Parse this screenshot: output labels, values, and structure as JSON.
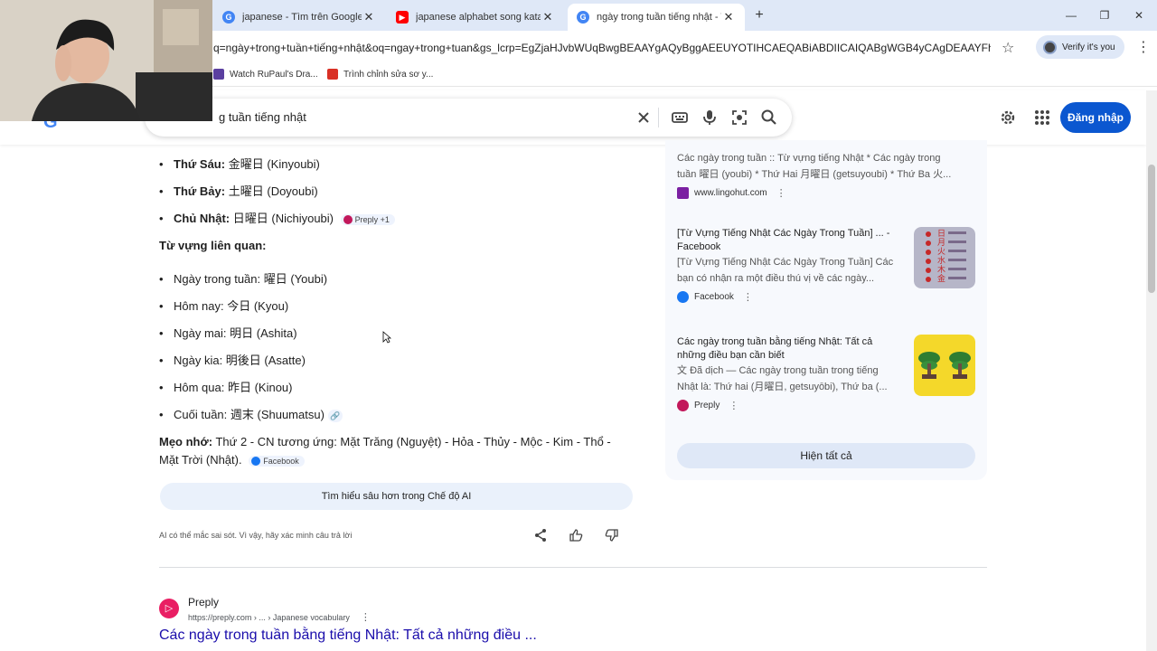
{
  "browser": {
    "tabs": [
      {
        "label": "japanese - Tìm trên Google",
        "favicon": "google-icon",
        "active": false
      },
      {
        "label": "japanese alphabet song katakana",
        "favicon": "youtube-icon",
        "active": false
      },
      {
        "label": "ngày trong tuần tiếng nhật - Tìm",
        "favicon": "google-icon",
        "active": true
      }
    ],
    "new_tab": "+",
    "url": "q=ngày+trong+tuần+tiếng+nhật&oq=ngay+trong+tuan&gs_lcrp=EgZjaHJvbWUqBwgBEAAYgAQyBggAEEUYOTIHCAEQABiABDIICAIQABgWGB4yCAgDEAAYFhgeMg...",
    "profile_label": "Verify it's you",
    "bookmarks": [
      {
        "label": "Watch RuPaul's Dra...",
        "icon": "bookmark-icon"
      },
      {
        "label": "Trình chỉnh sửa sơ y...",
        "icon": "bookmark-icon"
      }
    ]
  },
  "google": {
    "query": "ngày trong tuần tiếng nhật",
    "visible_query": "g tuần tiếng nhật",
    "signin_label": "Đăng nhập"
  },
  "ai_overview": {
    "days": [
      {
        "day": "Thứ Sáu:",
        "kanji": "金曜日",
        "romaji": "(Kinyoubi)"
      },
      {
        "day": "Thứ Bảy:",
        "kanji": "土曜日",
        "romaji": "(Doyoubi)"
      },
      {
        "day": "Chủ Nhật:",
        "kanji": "日曜日",
        "romaji": "(Nichiyoubi)",
        "chip": "Preply +1"
      }
    ],
    "related_heading": "Từ vựng liên quan:",
    "related": [
      {
        "text": "Ngày trong tuần: 曜日 (Youbi)"
      },
      {
        "text": "Hôm nay: 今日 (Kyou)"
      },
      {
        "text": "Ngày mai: 明日 (Ashita)"
      },
      {
        "text": "Ngày kia: 明後日 (Asatte)"
      },
      {
        "text": "Hôm qua: 昨日 (Kinou)"
      },
      {
        "text": "Cuối tuần: 週末 (Shuumatsu)"
      }
    ],
    "tip_label": "Mẹo nhớ:",
    "tip_text_1": "Thứ 2 - CN tương ứng: Mặt Trăng (Nguyệt) - Hỏa - Thủy - Mộc - Kim - Thổ -",
    "tip_text_2": "Mặt Trời (Nhật).",
    "tip_chip": "Facebook",
    "deep_dive_label": "Tìm hiểu sâu hơn trong Chế độ AI",
    "disclaimer": "AI có thể mắc sai sót. Vì vậy, hãy xác minh câu trả lời"
  },
  "sources": [
    {
      "title": "",
      "desc_1": "Các ngày trong tuần :: Từ vựng tiếng Nhật * Các ngày trong",
      "desc_2": "tuần 曜日 (youbi) * Thứ Hai 月曜日 (getsuyoubi) * Thứ Ba 火...",
      "site": "www.lingohut.com"
    },
    {
      "title_1": "[Từ Vựng Tiếng Nhật Các Ngày Trong Tuần] ... -",
      "title_2": "Facebook",
      "desc_1": "[Từ Vựng Tiếng Nhật Các Ngày Trong Tuần] Các",
      "desc_2": "bạn có nhận ra một điều thú vị về các ngày...",
      "site": "Facebook"
    },
    {
      "title_1": "Các ngày trong tuần bằng tiếng Nhật: Tất cả",
      "title_2": "những điều bạn cần biết",
      "desc_1": "Đã dịch — Các ngày trong tuần trong tiếng",
      "desc_2": "Nhật là: Thứ hai (月曜日, getsuyōbi), Thứ ba (...",
      "site": "Preply"
    }
  ],
  "show_all_label": "Hiện tất cả",
  "result": {
    "site": "Preply",
    "crumb": "https://preply.com › ... › Japanese vocabulary",
    "title": "Các ngày trong tuần bằng tiếng Nhật: Tất cả những điều ..."
  },
  "colors": {
    "accent": "#0b57d0",
    "link": "#1a0dab",
    "chrome": "#dfe8f7"
  }
}
